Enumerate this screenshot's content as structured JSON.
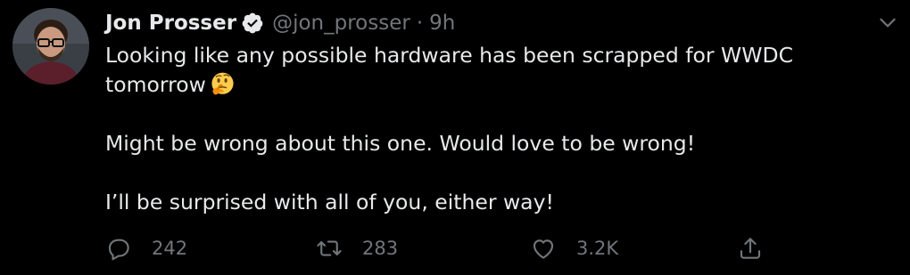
{
  "tweet": {
    "author": {
      "display_name": "Jon Prosser",
      "handle": "@jon_prosser",
      "verified": true,
      "avatar_icon": "user-avatar"
    },
    "separator": "·",
    "timestamp": "9h",
    "text": {
      "line1": "Looking like any possible hardware has been scrapped for WWDC",
      "line2": "tomorrow",
      "emoji": "thinking-face-emoji",
      "paragraph2": "Might be wrong about this one. Would love to be wrong!",
      "paragraph3": "I’ll be surprised with all of you, either way!"
    },
    "actions": {
      "reply_count": "242",
      "retweet_count": "283",
      "like_count": "3.2K"
    }
  },
  "colors": {
    "background": "#000000",
    "text_primary": "#e7e9ea",
    "text_secondary": "#71767b"
  }
}
